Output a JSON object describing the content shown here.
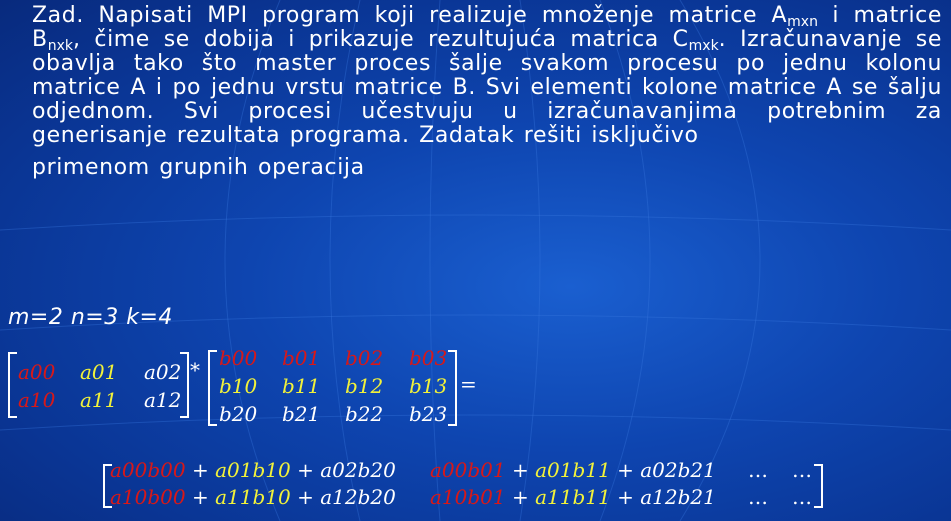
{
  "task": {
    "line1": "Zad. Napisati MPI program koji realizuje množenje matrice A",
    "sub_a": "mxn",
    "line1b": " i matrice B",
    "sub_b": "nxk",
    "line1c": ", čime se dobija i prikazuje rezultujuća matrica C",
    "sub_c": "mxk",
    "line1d": ". Izračunavanje se obavlja tako što master proces šalje svakom procesu po jednu kolonu matrice A i po jednu vrstu matrice B. Svi elementi kolone matrice A se šalju odjednom. Svi procesi učestvuju u izračunavanjima potrebnim za generisanje rezultata programa. Zadatak rešiti isključivo",
    "line_last": "primenom grupnih operacija"
  },
  "params": "m=2 n=3 k=4",
  "matrix_a": [
    [
      "a00",
      "a01",
      "a02"
    ],
    [
      "a10",
      "a11",
      "a12"
    ]
  ],
  "matrix_b": [
    [
      "b00",
      "b01",
      "b02",
      "b03"
    ],
    [
      "b10",
      "b11",
      "b12",
      "b13"
    ],
    [
      "b20",
      "b21",
      "b22",
      "b23"
    ]
  ],
  "ops": {
    "times": "*",
    "equals": "=",
    "plus": "+",
    "ellipsis": "…"
  },
  "result": {
    "r0c0": [
      "a00b00",
      "a01b10",
      "a02b20"
    ],
    "r0c1": [
      "a00b01",
      "a01b11",
      "a02b21"
    ],
    "r1c0": [
      "a10b00",
      "a11b10",
      "a12b20"
    ],
    "r1c1": [
      "a10b01",
      "a11b11",
      "a12b21"
    ]
  },
  "colors": {
    "red": "#d81818",
    "yellow": "#f2f23a",
    "white": "#ffffff",
    "background": "#0b3fa6"
  }
}
